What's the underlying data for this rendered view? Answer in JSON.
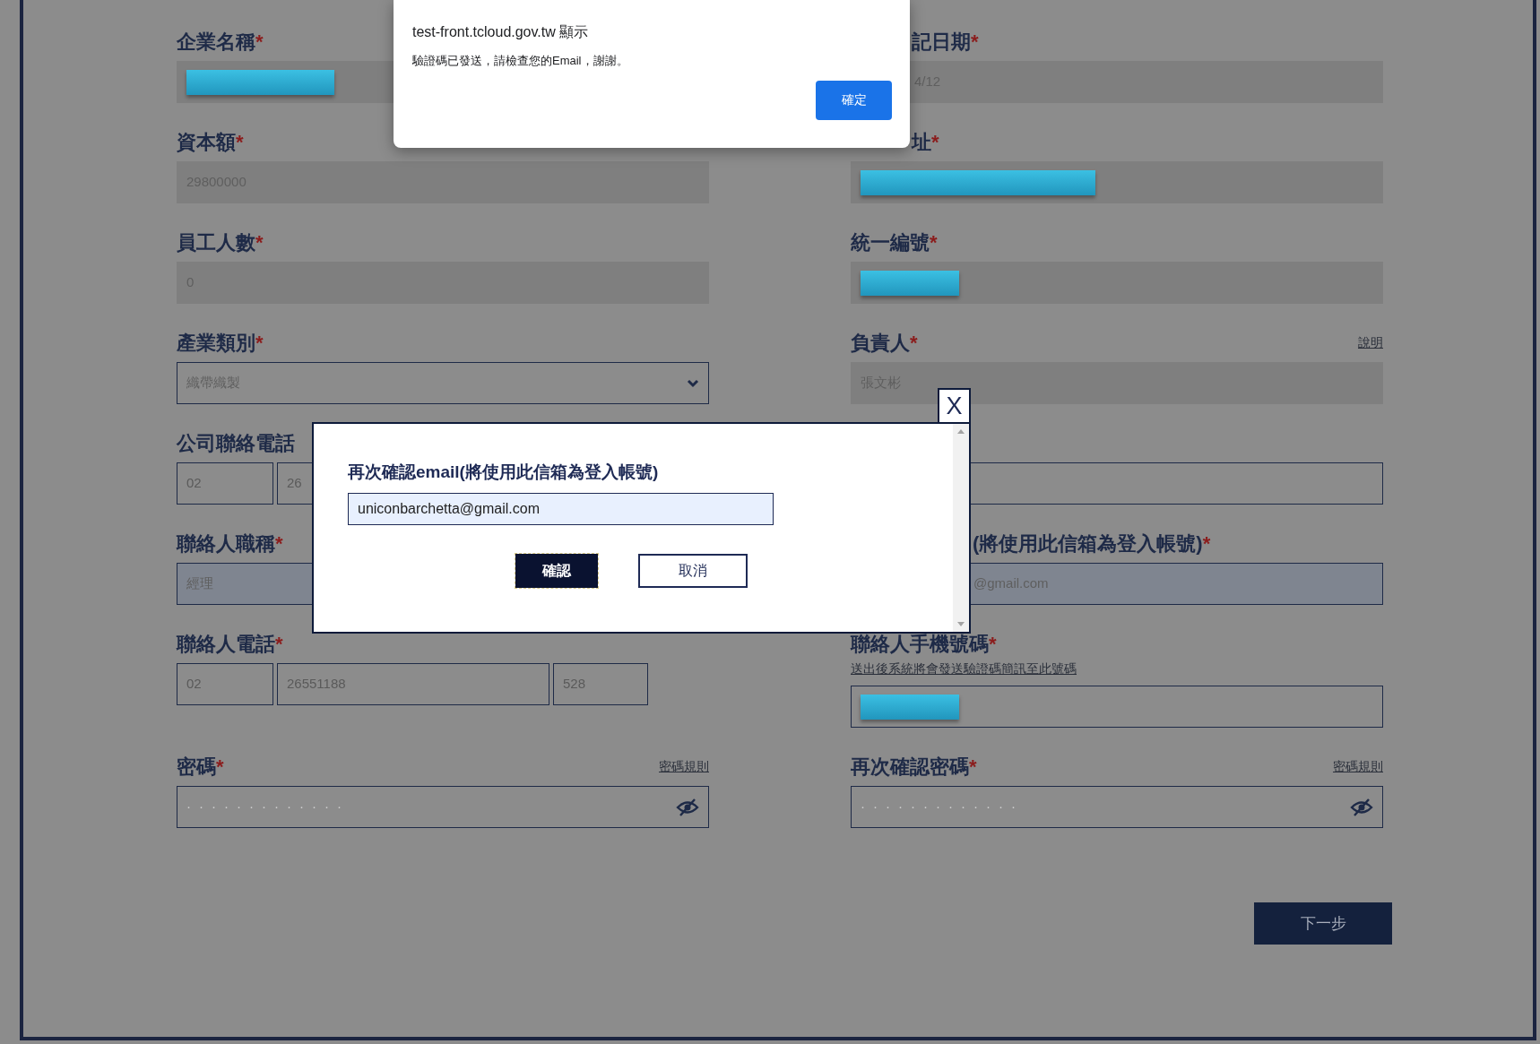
{
  "form": {
    "fields": [
      {
        "label": "企業名稱",
        "mark": "*",
        "kind": "text",
        "disabled": true,
        "redacted": true
      },
      {
        "label": "記日期",
        "mark": "*",
        "kind": "text",
        "disabled": true,
        "value": "4/12",
        "cut": true
      },
      {
        "label": "資本額",
        "mark": "*",
        "kind": "text",
        "disabled": true,
        "value": "29800000"
      },
      {
        "label": "址",
        "mark": "*",
        "kind": "text",
        "disabled": true,
        "redacted": true,
        "cut": true
      },
      {
        "label": "員工人數",
        "mark": "*",
        "kind": "text",
        "disabled": true,
        "value": "0"
      },
      {
        "label": "統一編號",
        "mark": "*",
        "kind": "text",
        "disabled": true,
        "redacted": true
      },
      {
        "label": "產業類別",
        "mark": "*",
        "kind": "select",
        "disabled": false,
        "value": "織帶織製"
      },
      {
        "label": "負責人",
        "mark": "*",
        "kind": "text",
        "disabled": true,
        "value": "張文彬",
        "link": "說明"
      },
      {
        "label": "公司聯絡電話",
        "kind": "phone",
        "parts": [
          "02",
          "26"
        ]
      },
      {
        "kind": "text",
        "disabled": false
      },
      {
        "label": "聯絡人職稱",
        "mark": "*",
        "kind": "text",
        "disabled": false,
        "autofilled": true,
        "value": "經理"
      },
      {
        "label": "(將使用此信箱為登入帳號)",
        "mark": "*",
        "kind": "text",
        "disabled": false,
        "autofilled": true,
        "value": "@gmail.com",
        "cut": true
      },
      {
        "label": "聯絡人電話",
        "mark": "*",
        "kind": "phone",
        "parts": [
          "02",
          "26551188",
          "528"
        ]
      },
      {
        "label": "聯絡人手機號碼",
        "mark": "*",
        "kind": "text",
        "disabled": false,
        "note": "送出後系統將會發送驗證碼簡訊至此號碼",
        "redacted": true
      },
      {
        "label": "密碼",
        "mark": "*",
        "kind": "password",
        "disabled": false,
        "value": "·············",
        "link": "密碼規則"
      },
      {
        "label": "再次確認密碼",
        "mark": "*",
        "kind": "password",
        "disabled": false,
        "value": "·············",
        "link": "密碼規則"
      }
    ],
    "next_button": "下一步"
  },
  "modal": {
    "title": "再次確認email(將使用此信箱為登入帳號)",
    "email_value": "uniconbarchetta@gmail.com",
    "confirm_button": "確認",
    "cancel_button": "取消",
    "close_button": "X"
  },
  "alert": {
    "title": "test-front.tcloud.gov.tw 顯示",
    "message": "驗證碼已發送，請檢查您的Email，謝謝。",
    "button": "確定"
  }
}
